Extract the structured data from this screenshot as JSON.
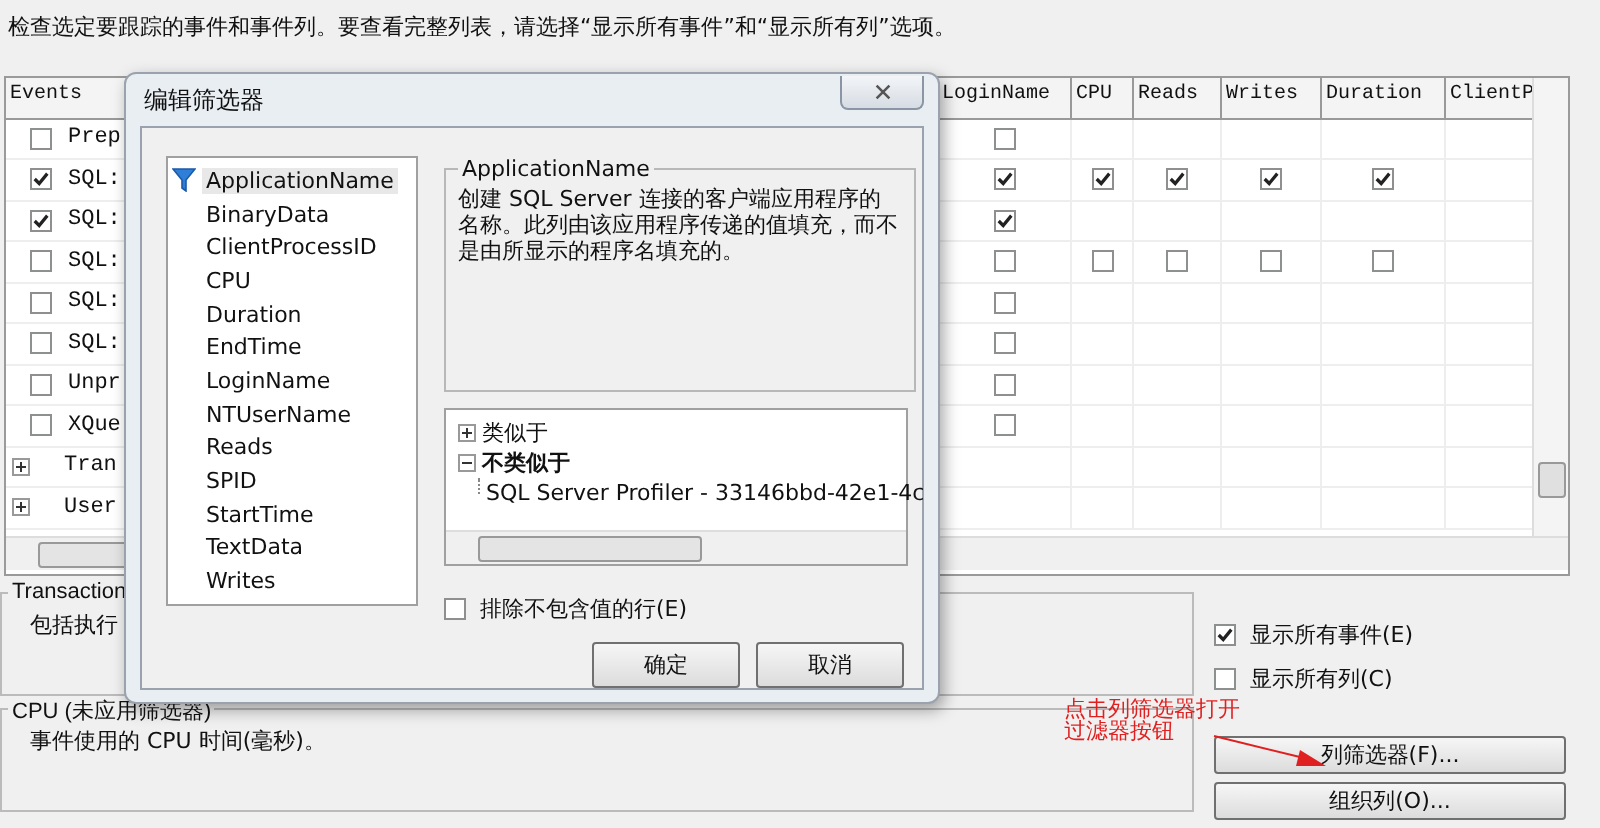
{
  "instructions": "检查选定要跟踪的事件和事件列。要查看完整列表，请选择“显示所有事件”和“显示所有列”选项。",
  "grid": {
    "columns": [
      "Events",
      "",
      "LoginName",
      "CPU",
      "Reads",
      "Writes",
      "Duration",
      "ClientP"
    ],
    "rows": [
      {
        "kind": "event",
        "label": "Prep",
        "checked": false,
        "cells": [
          null,
          false,
          null,
          null,
          null,
          null,
          null
        ]
      },
      {
        "kind": "event",
        "label": "SQL:",
        "checked": true,
        "cells": [
          null,
          true,
          true,
          true,
          true,
          true,
          null
        ]
      },
      {
        "kind": "event",
        "label": "SQL:",
        "checked": true,
        "cells": [
          null,
          true,
          null,
          null,
          null,
          null,
          null
        ]
      },
      {
        "kind": "event",
        "label": "SQL:",
        "checked": false,
        "cells": [
          null,
          false,
          false,
          false,
          false,
          false,
          null
        ]
      },
      {
        "kind": "event",
        "label": "SQL:",
        "checked": false,
        "cells": [
          null,
          false,
          null,
          null,
          null,
          null,
          null
        ]
      },
      {
        "kind": "event",
        "label": "SQL:",
        "checked": false,
        "cells": [
          null,
          false,
          null,
          null,
          null,
          null,
          null
        ]
      },
      {
        "kind": "event",
        "label": "Unpr",
        "checked": false,
        "cells": [
          null,
          false,
          null,
          null,
          null,
          null,
          null
        ]
      },
      {
        "kind": "event",
        "label": "XQue",
        "checked": false,
        "cells": [
          null,
          false,
          null,
          null,
          null,
          null,
          null
        ]
      },
      {
        "kind": "category",
        "label": "Tran",
        "expanded": false,
        "cells": [
          null,
          null,
          null,
          null,
          null,
          null,
          null
        ]
      },
      {
        "kind": "category",
        "label": "User",
        "expanded": false,
        "cells": [
          null,
          null,
          null,
          null,
          null,
          null,
          null
        ]
      }
    ]
  },
  "event_info": {
    "legend": "Transaction",
    "text": "包括执行"
  },
  "column_info": {
    "legend": "CPU (未应用筛选器)",
    "text": "事件使用的 CPU 时间(毫秒)。"
  },
  "options": [
    {
      "label": "显示所有事件(E)",
      "checked": true
    },
    {
      "label": "显示所有列(C)",
      "checked": false
    }
  ],
  "annotation": [
    "点击列筛选器打开",
    "过滤器按钮"
  ],
  "buttons": [
    "列筛选器(F)...",
    "组织列(O)..."
  ],
  "dialog": {
    "title": "编辑筛选器",
    "columns": [
      {
        "label": "ApplicationName",
        "selected": true,
        "filtered": true
      },
      {
        "label": "BinaryData",
        "selected": false,
        "filtered": false
      },
      {
        "label": "ClientProcessID",
        "selected": false,
        "filtered": false
      },
      {
        "label": "CPU",
        "selected": false,
        "filtered": false
      },
      {
        "label": "Duration",
        "selected": false,
        "filtered": false
      },
      {
        "label": "EndTime",
        "selected": false,
        "filtered": false
      },
      {
        "label": "LoginName",
        "selected": false,
        "filtered": false
      },
      {
        "label": "NTUserName",
        "selected": false,
        "filtered": false
      },
      {
        "label": "Reads",
        "selected": false,
        "filtered": false
      },
      {
        "label": "SPID",
        "selected": false,
        "filtered": false
      },
      {
        "label": "StartTime",
        "selected": false,
        "filtered": false
      },
      {
        "label": "TextData",
        "selected": false,
        "filtered": false
      },
      {
        "label": "Writes",
        "selected": false,
        "filtered": false
      }
    ],
    "description": {
      "legend": "ApplicationName",
      "text": "创建 SQL Server 连接的客户端应用程序的名称。此列由该应用程序传递的值填充，而不是由所显示的程序名填充的。"
    },
    "tree": [
      {
        "label": "类似于",
        "bold": false,
        "expanded": false
      },
      {
        "label": "不类似于",
        "bold": true,
        "expanded": true,
        "children": [
          {
            "label": "SQL Server Profiler - 33146bbd-42e1-4c"
          }
        ]
      }
    ],
    "exclude": {
      "label": "排除不包含值的行(E)",
      "checked": false
    },
    "buttons": [
      "确定",
      "取消"
    ]
  }
}
